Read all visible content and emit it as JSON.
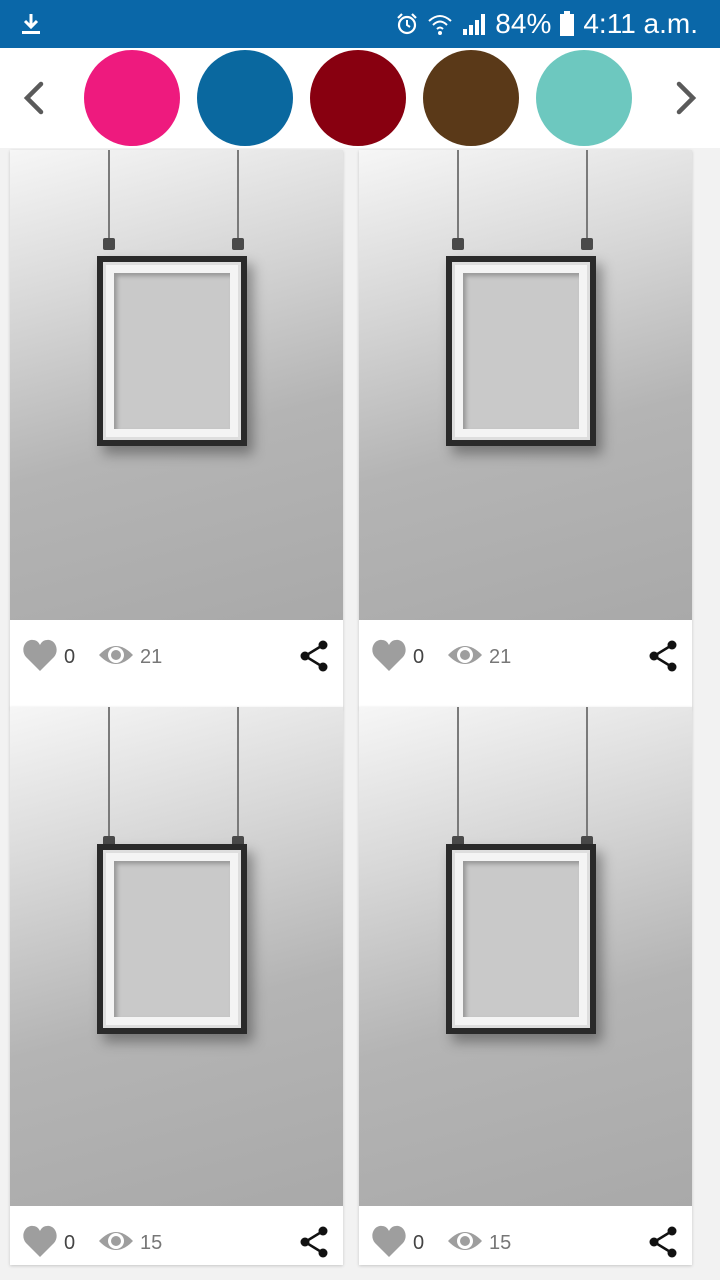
{
  "status_bar": {
    "battery": "84%",
    "time": "4:11 a.m.",
    "icons": [
      "download-icon",
      "alarm-icon",
      "wifi-icon",
      "signal-icon",
      "battery-icon"
    ]
  },
  "color_filter": {
    "prev_icon": "chevron-left-icon",
    "next_icon": "chevron-right-icon",
    "swatches": [
      "#ee1a7e",
      "#0a689f",
      "#880010",
      "#5a3918",
      "#6dc8bf"
    ]
  },
  "cards": [
    {
      "likes": "0",
      "views": "21"
    },
    {
      "likes": "0",
      "views": "21"
    },
    {
      "likes": "0",
      "views": "15"
    },
    {
      "likes": "0",
      "views": "15"
    }
  ]
}
